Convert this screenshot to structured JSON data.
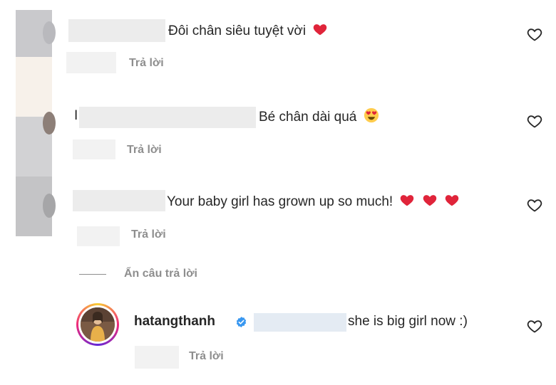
{
  "comments": [
    {
      "text": "Đôi chân siêu tuyệt vời",
      "emojis": [
        "red-heart"
      ],
      "reply_label": "Trả lời"
    },
    {
      "prefix": "I",
      "text": "Bé chân dài quá",
      "emojis": [
        "heart-eyes"
      ],
      "reply_label": "Trả lời"
    },
    {
      "text": "Your baby girl has grown up so much!",
      "emojis": [
        "red-heart",
        "red-heart",
        "red-heart"
      ],
      "reply_label": "Trả lời"
    }
  ],
  "hide_replies_label": "Ẩn câu trả lời",
  "reply": {
    "username": "hatangthanh",
    "verified": true,
    "text": "she is big girl now :)",
    "reply_label": "Trả lời"
  },
  "colors": {
    "text": "#262626",
    "secondary": "#8e8e8e",
    "heart": "#ed4956",
    "verified": "#3897f0"
  },
  "icons": [
    "heart-outline-icon",
    "red-heart-emoji",
    "heart-eyes-emoji",
    "verified-badge-icon"
  ]
}
